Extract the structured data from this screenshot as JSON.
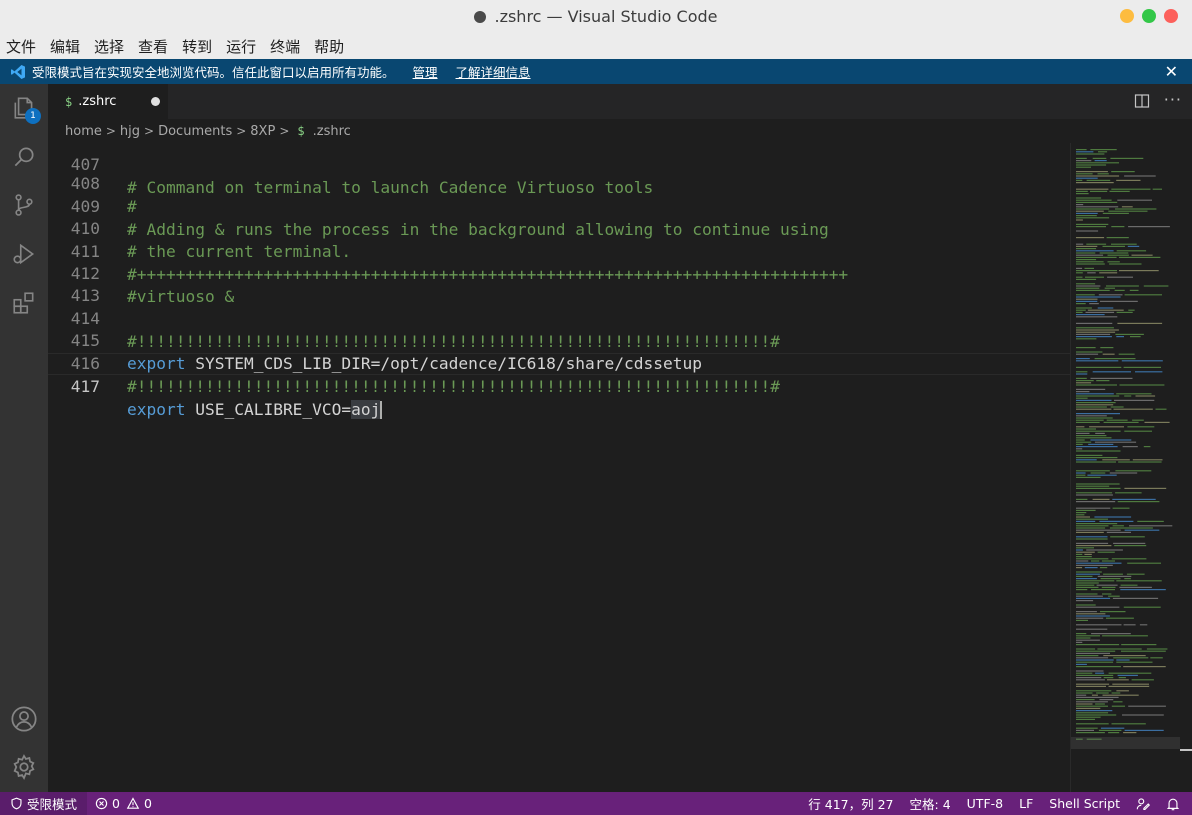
{
  "window": {
    "title": ".zshrc — Visual Studio Code",
    "traffic_lights": [
      "#fdbc40",
      "#33c748",
      "#fc605b"
    ]
  },
  "menu": [
    "文件",
    "编辑",
    "选择",
    "查看",
    "转到",
    "运行",
    "终端",
    "帮助"
  ],
  "banner": {
    "message": "受限模式旨在实现安全地浏览代码。信任此窗口以启用所有功能。",
    "manage_link": "管理",
    "learn_more_link": "了解详细信息",
    "close_icon": "close-icon"
  },
  "activity_bar": {
    "items": [
      "files-icon",
      "search-icon",
      "source-control-icon",
      "run-debug-icon",
      "extensions-icon"
    ],
    "explorer_badge": "1",
    "bottom": [
      "account-icon",
      "gear-icon"
    ]
  },
  "tab": {
    "icon": "$",
    "label": ".zshrc"
  },
  "breadcrumb": {
    "parts": [
      "home",
      "hjg",
      "Documents",
      "8XP"
    ],
    "file_icon": "$",
    "file": ".zshrc"
  },
  "editor": {
    "lines": [
      {
        "num": "407",
        "kind": "comment",
        "text": "# Command on terminal to launch Cadence Virtuoso tools"
      },
      {
        "num": "408",
        "kind": "comment",
        "text": "#"
      },
      {
        "num": "409",
        "kind": "comment",
        "text": "# Adding & runs the process in the background allowing to continue using"
      },
      {
        "num": "410",
        "kind": "comment",
        "text": "# the current terminal."
      },
      {
        "num": "411",
        "kind": "comment",
        "text": "#+++++++++++++++++++++++++++++++++++++++++++++++++++++++++++++++++++++++++"
      },
      {
        "num": "412",
        "kind": "comment",
        "text": "#virtuoso &"
      },
      {
        "num": "413",
        "kind": "empty",
        "text": ""
      },
      {
        "num": "414",
        "kind": "comment",
        "text": "#!!!!!!!!!!!!!!!!!!!!!!!!!!!!!!!!!!!!!!!!!!!!!!!!!!!!!!!!!!!!!!!!!#"
      },
      {
        "num": "415",
        "kind": "export",
        "keyword": "export",
        "text": " SYSTEM_CDS_LIB_DIR=/opt/cadence/IC618/share/cdssetup"
      },
      {
        "num": "416",
        "kind": "comment",
        "text": "#!!!!!!!!!!!!!!!!!!!!!!!!!!!!!!!!!!!!!!!!!!!!!!!!!!!!!!!!!!!!!!!!!#"
      },
      {
        "num": "417",
        "kind": "export",
        "keyword": "export",
        "text": " USE_CALIBRE_VCO=",
        "selected": "aoj",
        "current": true
      }
    ]
  },
  "status_bar": {
    "restricted_mode": "受限模式",
    "errors": "0",
    "warnings": "0",
    "position": "行 417，列 27",
    "indent": "空格: 4",
    "encoding": "UTF-8",
    "eol": "LF",
    "language": "Shell Script"
  },
  "colors": {
    "status_bar": "#68217a",
    "banner": "#094771",
    "comment": "#6a9955",
    "keyword": "#569cd6"
  }
}
